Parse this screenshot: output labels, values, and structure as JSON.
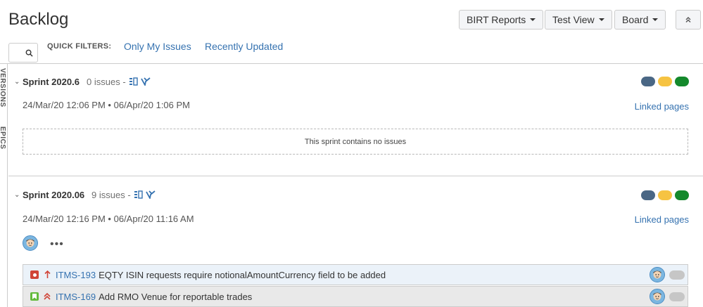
{
  "page": {
    "title": "Backlog"
  },
  "header_buttons": {
    "birt": "BIRT Reports",
    "test_view": "Test View",
    "board": "Board"
  },
  "quick_filters": {
    "label": "QUICK FILTERS:",
    "only_my_issues": "Only My Issues",
    "recently_updated": "Recently Updated"
  },
  "side_tabs": {
    "versions": "VERSIONS",
    "epics": "EPICS"
  },
  "colors": {
    "link": "#3572b0",
    "dot_blue": "#4a6785",
    "dot_yellow": "#f6c342",
    "dot_green": "#14892c",
    "bug": "#d04437",
    "story": "#63ba3c"
  },
  "sprints": [
    {
      "name": "Sprint 2020.6",
      "count": "0 issues",
      "dates_start": "24/Mar/20 12:06 PM",
      "dates_end": "06/Apr/20 1:06 PM",
      "linked_pages": "Linked pages",
      "empty_message": "This sprint contains no issues"
    },
    {
      "name": "Sprint 2020.06",
      "count": "9 issues",
      "dates_start": "24/Mar/20 12:16 PM",
      "dates_end": "06/Apr/20 11:16 AM",
      "linked_pages": "Linked pages",
      "more": "•••",
      "issues": [
        {
          "key": "ITMS-193",
          "summary": "EQTY ISIN requests require notionalAmountCurrency field to be added",
          "type_icon": "bug-icon",
          "priority_icon": "priority-highest-icon"
        },
        {
          "key": "ITMS-169",
          "summary": "Add RMO Venue for reportable trades",
          "type_icon": "story-icon",
          "priority_icon": "priority-high-icon"
        }
      ]
    }
  ],
  "separators": {
    "dash": "-",
    "bullet": "•"
  }
}
